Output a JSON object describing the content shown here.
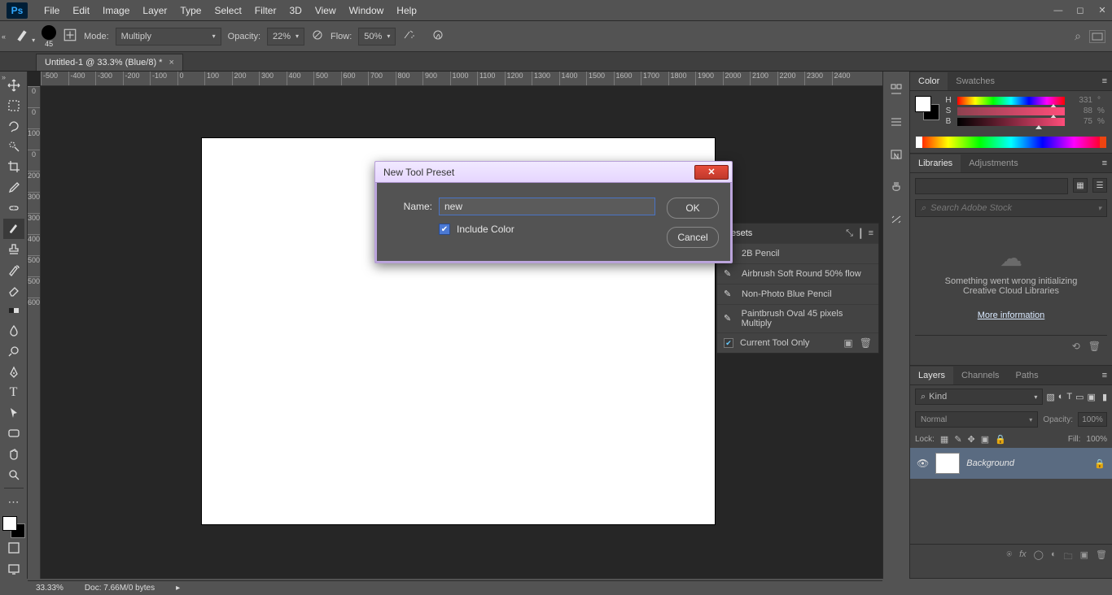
{
  "menu": {
    "items": [
      "File",
      "Edit",
      "Image",
      "Layer",
      "Type",
      "Select",
      "Filter",
      "3D",
      "View",
      "Window",
      "Help"
    ]
  },
  "options": {
    "brush_size": "45",
    "mode_label": "Mode:",
    "mode_value": "Multiply",
    "opacity_label": "Opacity:",
    "opacity_value": "22%",
    "flow_label": "Flow:",
    "flow_value": "50%"
  },
  "document": {
    "tab_title": "Untitled-1 @ 33.3% (Blue/8) *"
  },
  "ruler_h": [
    "-500",
    "-400",
    "-300",
    "-200",
    "-100",
    "0",
    "100",
    "200",
    "300",
    "400",
    "500",
    "600",
    "700",
    "800",
    "900",
    "1000",
    "1100",
    "1200",
    "1300",
    "1400",
    "1500",
    "1600",
    "1700",
    "1800",
    "1900",
    "2000",
    "2100",
    "2200",
    "2300",
    "2400"
  ],
  "ruler_v": [
    "0",
    "0",
    "100",
    "0",
    "200",
    "300",
    "300",
    "400",
    "500",
    "500",
    "600"
  ],
  "color_panel": {
    "tab_color": "Color",
    "tab_swatches": "Swatches",
    "h": {
      "label": "H",
      "value": "331",
      "unit": "°"
    },
    "s": {
      "label": "S",
      "value": "88",
      "unit": "%"
    },
    "b": {
      "label": "B",
      "value": "75",
      "unit": "%"
    }
  },
  "libraries": {
    "tab_lib": "Libraries",
    "tab_adj": "Adjustments",
    "search_placeholder": "Search Adobe Stock",
    "msg_line1": "Something went wrong initializing",
    "msg_line2": "Creative Cloud Libraries",
    "link": "More information"
  },
  "layers": {
    "tab_layers": "Layers",
    "tab_channels": "Channels",
    "tab_paths": "Paths",
    "kind": "Kind",
    "blend": "Normal",
    "opacity_label": "Opacity:",
    "opacity": "100%",
    "lock_label": "Lock:",
    "fill_label": "Fill:",
    "fill": "100%",
    "layer_name": "Background"
  },
  "presets": {
    "title": "Presets",
    "items": [
      "2B Pencil",
      "Airbrush Soft Round 50% flow",
      "Non-Photo Blue Pencil",
      "Paintbrush Oval 45 pixels Multiply"
    ],
    "current_only": "Current Tool Only"
  },
  "dialog": {
    "title": "New Tool Preset",
    "name_label": "Name:",
    "name_value": "new",
    "include_color": "Include Color",
    "ok": "OK",
    "cancel": "Cancel"
  },
  "status": {
    "zoom": "33.33%",
    "doc": "Doc: 7.66M/0 bytes"
  }
}
